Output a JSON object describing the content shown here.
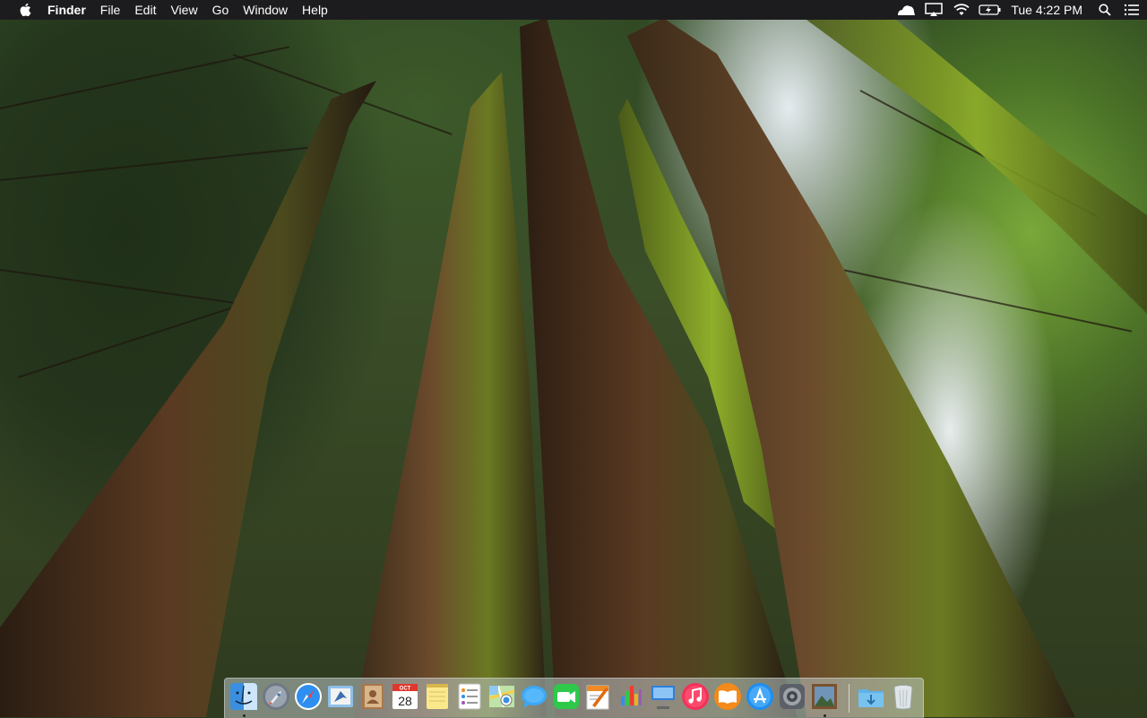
{
  "menubar": {
    "app_name": "Finder",
    "menus": [
      "File",
      "Edit",
      "View",
      "Go",
      "Window",
      "Help"
    ],
    "clock": "Tue 4:22 PM",
    "status_icons": [
      "notification-cloud-icon",
      "airplay-icon",
      "wifi-icon",
      "battery-charging-icon",
      "spotlight-search-icon",
      "notification-center-icon"
    ]
  },
  "dock": {
    "apps": [
      {
        "name": "Finder",
        "icon": "finder-icon",
        "running": true
      },
      {
        "name": "Launchpad",
        "icon": "launchpad-icon",
        "running": false
      },
      {
        "name": "Safari",
        "icon": "safari-icon",
        "running": false
      },
      {
        "name": "Mail",
        "icon": "mail-icon",
        "running": false
      },
      {
        "name": "Contacts",
        "icon": "contacts-icon",
        "running": false
      },
      {
        "name": "Calendar",
        "icon": "calendar-icon",
        "running": false,
        "month": "OCT",
        "day": "28"
      },
      {
        "name": "Notes",
        "icon": "notes-icon",
        "running": false
      },
      {
        "name": "Reminders",
        "icon": "reminders-icon",
        "running": false
      },
      {
        "name": "Maps",
        "icon": "maps-icon",
        "running": false
      },
      {
        "name": "Messages",
        "icon": "messages-icon",
        "running": false
      },
      {
        "name": "FaceTime",
        "icon": "facetime-icon",
        "running": false
      },
      {
        "name": "Pages",
        "icon": "pages-icon",
        "running": false
      },
      {
        "name": "Numbers",
        "icon": "numbers-icon",
        "running": false
      },
      {
        "name": "Keynote",
        "icon": "keynote-icon",
        "running": false
      },
      {
        "name": "iTunes",
        "icon": "itunes-icon",
        "running": false
      },
      {
        "name": "iBooks",
        "icon": "ibooks-icon",
        "running": false
      },
      {
        "name": "App Store",
        "icon": "app-store-icon",
        "running": false
      },
      {
        "name": "System Preferences",
        "icon": "system-preferences-icon",
        "running": false
      },
      {
        "name": "Preview",
        "icon": "preview-icon",
        "running": true
      }
    ],
    "stacks": [
      {
        "name": "Downloads",
        "icon": "downloads-folder-icon"
      },
      {
        "name": "Trash",
        "icon": "trash-icon"
      }
    ]
  }
}
